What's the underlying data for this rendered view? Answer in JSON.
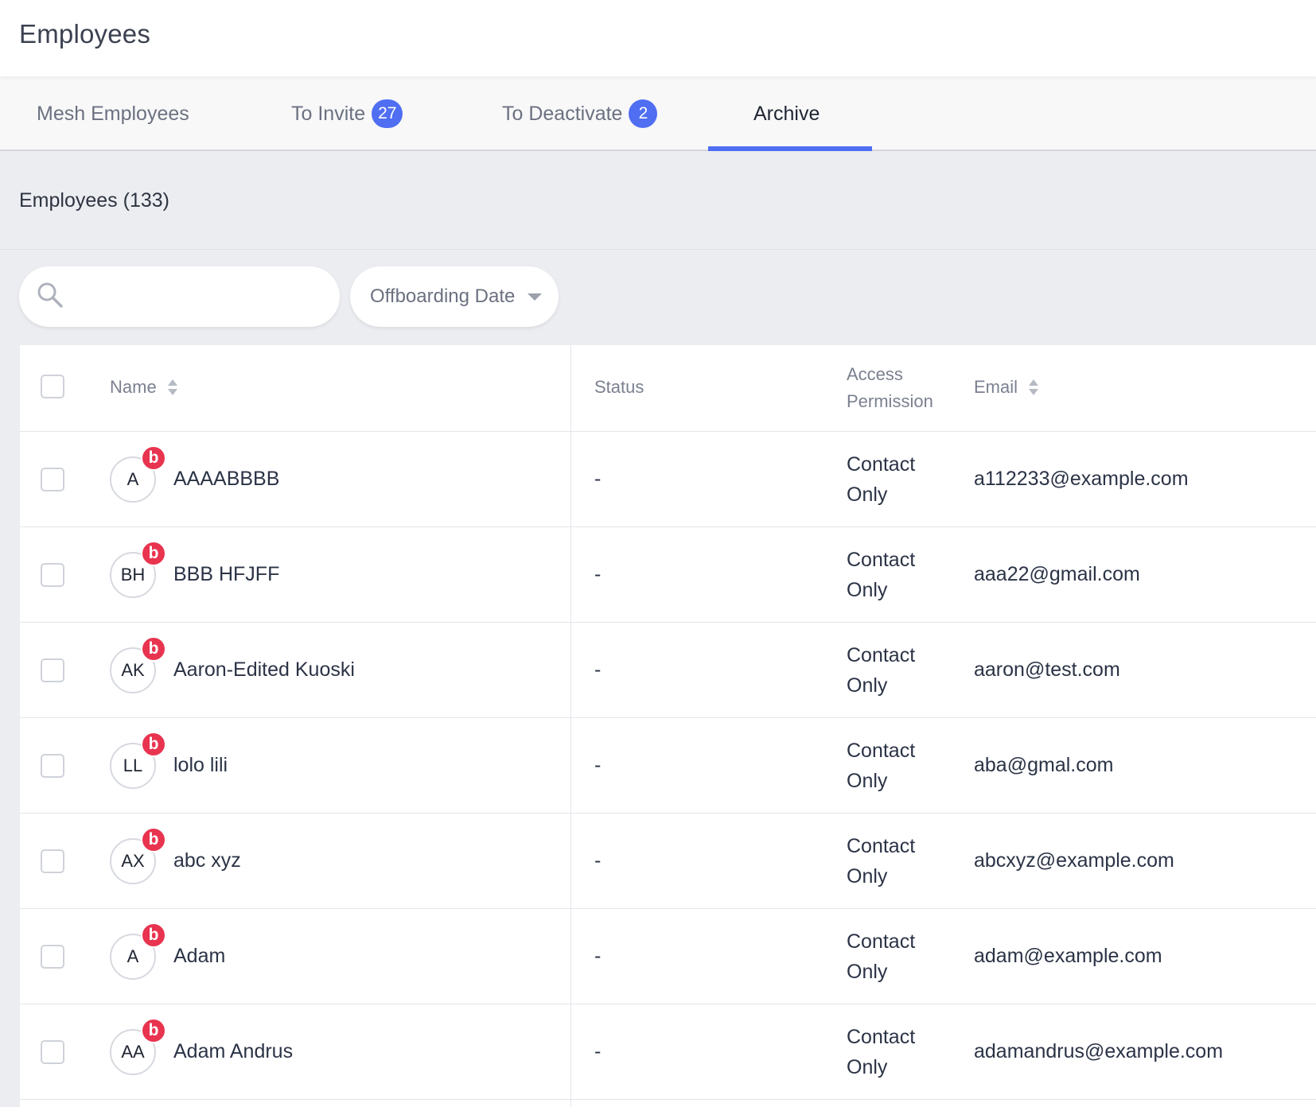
{
  "header": {
    "title": "Employees"
  },
  "tabs": [
    {
      "label": "Mesh Employees",
      "badge": ""
    },
    {
      "label": "To Invite",
      "badge": "27"
    },
    {
      "label": "To Deactivate",
      "badge": "2"
    },
    {
      "label": "Archive",
      "badge": ""
    }
  ],
  "active_tab": "Archive",
  "section": {
    "title": "Employees (133)"
  },
  "search": {
    "placeholder": "",
    "value": ""
  },
  "filter": {
    "label": "Offboarding Date"
  },
  "table": {
    "columns": [
      "Name",
      "Status",
      "Access Permission",
      "Email"
    ],
    "access_header": {
      "line1": "Access",
      "line2": "Permission"
    },
    "rows": [
      {
        "initials": "A",
        "badge": "b",
        "name": "AAAABBBB",
        "status": "-",
        "access1": "Contact",
        "access2": "Only",
        "email": "a112233@example.com"
      },
      {
        "initials": "BH",
        "badge": "b",
        "name": "BBB HFJFF",
        "status": "-",
        "access1": "Contact",
        "access2": "Only",
        "email": "aaa22@gmail.com"
      },
      {
        "initials": "AK",
        "badge": "b",
        "name": "Aaron-Edited Kuoski",
        "status": "-",
        "access1": "Contact",
        "access2": "Only",
        "email": "aaron@test.com"
      },
      {
        "initials": "LL",
        "badge": "b",
        "name": "lolo lili",
        "status": "-",
        "access1": "Contact",
        "access2": "Only",
        "email": "aba@gmal.com"
      },
      {
        "initials": "AX",
        "badge": "b",
        "name": "abc xyz",
        "status": "-",
        "access1": "Contact",
        "access2": "Only",
        "email": "abcxyz@example.com"
      },
      {
        "initials": "A",
        "badge": "b",
        "name": "Adam",
        "status": "-",
        "access1": "Contact",
        "access2": "Only",
        "email": "adam@example.com"
      },
      {
        "initials": "AA",
        "badge": "b",
        "name": "Adam Andrus",
        "status": "-",
        "access1": "Contact",
        "access2": "Only",
        "email": "adamandrus@example.com"
      }
    ]
  },
  "colors": {
    "accent": "#4f6ef2",
    "avatar_badge": "#e8344f",
    "background": "#ecedf1"
  },
  "icons": {
    "search": "search-icon",
    "dropdown": "chevron-down-icon",
    "sort": "sort-icon"
  }
}
